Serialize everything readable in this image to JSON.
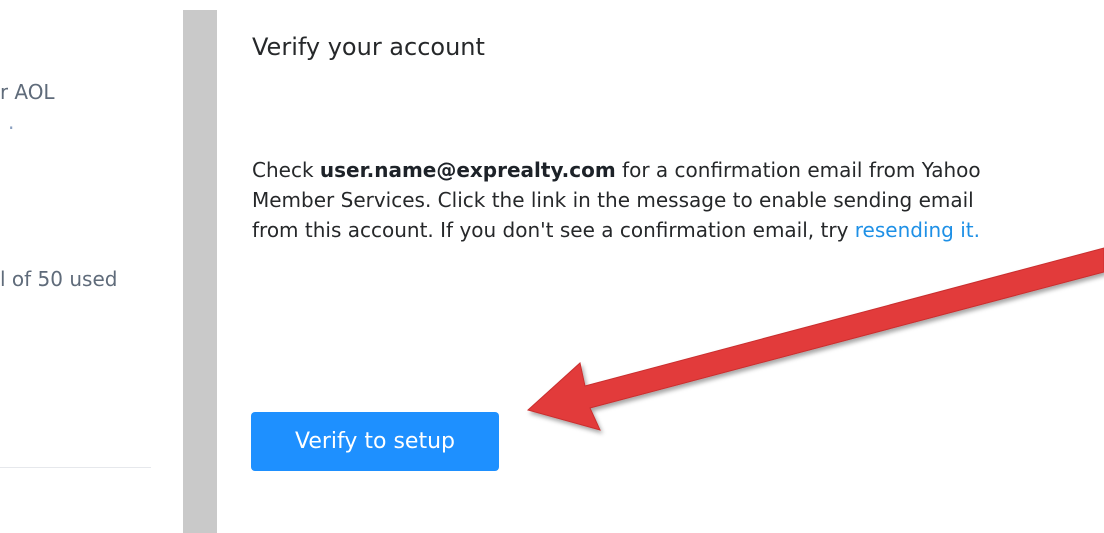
{
  "left_panel": {
    "provider_text": "AOL",
    "usage_text": "l of 50 used"
  },
  "dialog": {
    "title": "Verify your account",
    "body_prefix": "Check ",
    "email": "user.name@exprealty.com",
    "body_suffix": " for a confirmation email from Yahoo Member Services. Click the link in the message to enable sending email from this account. If you don't see a confirmation email, try ",
    "resend_link": "resending it.",
    "verify_button": "Verify to setup"
  },
  "colors": {
    "button": "#1e90ff",
    "link": "#1e90e6",
    "arrow": "#e23b3b",
    "divider": "#c9c9c9"
  },
  "annotation": {
    "arrow_icon": "red-arrow-icon"
  }
}
